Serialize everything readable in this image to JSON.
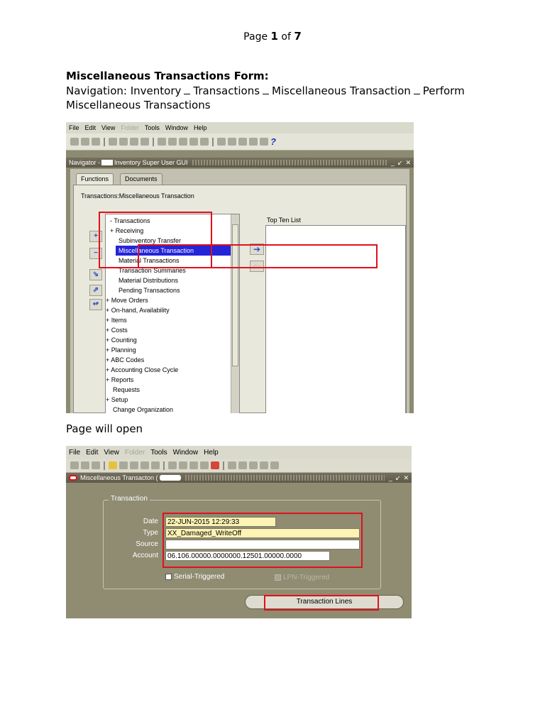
{
  "page": {
    "label": "Page",
    "num": "1",
    "of": "of",
    "total": "7"
  },
  "doc": {
    "title": "Miscellaneous Transactions Form:",
    "nav_prefix": "Navigation:",
    "nav_1": "Inventory",
    "nav_2": "Transactions",
    "nav_3": "Miscellaneous Transaction",
    "nav_4": "Perform Miscellaneous Transactions",
    "page_open": "Page will open"
  },
  "navigator": {
    "menu": [
      "File",
      "Edit",
      "View",
      "Folder",
      "Tools",
      "Window",
      "Help"
    ],
    "title": "Navigator - ",
    "title_suffix": "Inventory Super User GUI",
    "tabs": {
      "functions": "Functions",
      "documents": "Documents"
    },
    "path": "Transactions:Miscellaneous Transaction",
    "top_ten_label": "Top Ten List",
    "items": [
      {
        "label": "- Transactions"
      },
      {
        "label": "+ Receiving"
      },
      {
        "label": "Subinventory Transfer"
      },
      {
        "label": "Miscellaneous Transaction"
      },
      {
        "label": "Material Transactions"
      },
      {
        "label": "Transaction Summaries"
      },
      {
        "label": "Material Distributions"
      },
      {
        "label": "Pending Transactions"
      },
      {
        "label": "+ Move Orders"
      },
      {
        "label": "+ On-hand, Availability"
      },
      {
        "label": "+ Items"
      },
      {
        "label": "+ Costs"
      },
      {
        "label": "+ Counting"
      },
      {
        "label": "+ Planning"
      },
      {
        "label": "+ ABC Codes"
      },
      {
        "label": "+ Accounting Close Cycle"
      },
      {
        "label": "+ Reports"
      },
      {
        "label": "Requests"
      },
      {
        "label": "+ Setup"
      },
      {
        "label": "Change Organization"
      }
    ]
  },
  "misc_form": {
    "menu": [
      "File",
      "Edit",
      "View",
      "Folder",
      "Tools",
      "Window",
      "Help"
    ],
    "title": "Miscellaneous Transacton (",
    "group_label": "Transaction",
    "date_label": "Date",
    "date_value": "22-JUN-2015 12:29:33",
    "type_label": "Type",
    "type_value": "XX_Damaged_WriteOff",
    "source_label": "Source",
    "source_value": "",
    "account_label": "Account",
    "account_value": "06.106.00000.0000000.12501.00000.0000",
    "serial_label": "Serial-Triggered",
    "lpn_label": "LPN-Triggered",
    "lines_button": "Transaction Lines"
  }
}
